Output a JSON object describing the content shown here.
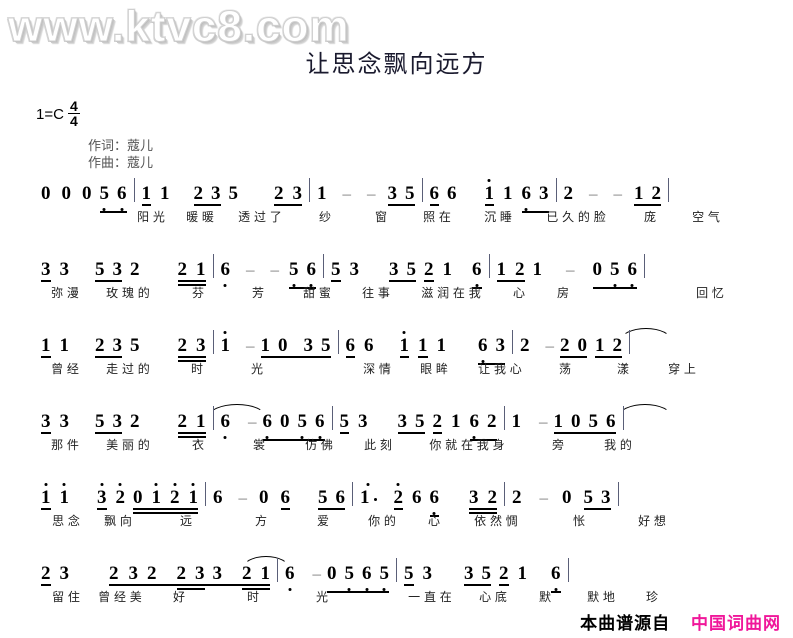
{
  "watermark": "www.ktvc8.com",
  "title": "让思念飘向远方",
  "key": {
    "tonic": "1=C",
    "meter_numerator": "4",
    "meter_denominator": "4"
  },
  "credits": {
    "lyricist": "作词：蔻儿",
    "composer": "作曲：蔻儿"
  },
  "footer": {
    "source_label": "本曲谱源自",
    "site_name": "中国词曲网",
    "site_color": "#f0179a"
  },
  "score": {
    "notation": "jianpu",
    "lines": [
      {
        "id": "line-1",
        "notes": "0 0 0 5̣ 6̣ | 1 1 2 3 5 | 2 3 | 1 - 3 5 | 6 6 | 1̇ 1 6 3 | 2 - - 1 2 |",
        "lyrics": "阳光 暖暖 透过了 纱 窗 照在 沉睡 已久的脸 庞 空气"
      },
      {
        "id": "line-2",
        "notes": "3 3 5 3 2 | 2 1 | 6̣ - - 5̣ 6̣ | 5 3 | 3 5 2 1 6̣ | 1 2 1 - 0 5̣ 6̣ |",
        "lyrics": "弥漫 玫瑰的 芬 芳 甜蜜 往事 滋润在我 心 房 回忆"
      },
      {
        "id": "line-3",
        "notes": "1 1 2 3 5 | 2 3 | 1̇ - 1 0 3 5 | 6 6 | 1̇ 1 1 | 6 3 | 2 - 2 0 1 2 |",
        "lyrics": "曾经 走过的 时 光 深情 眼眸 让我心 荡 漾 穿上"
      },
      {
        "id": "line-4",
        "notes": "3 3 5 3 2 | 2 1 | 6̣ - 6̣ 0 5̣ 6̣ | 5 3 | 3 5 2 1 6̣ 2 | 1 - 1 0 5 6 |",
        "lyrics": "那件 美丽的 衣 裳 仿佛 此刻 你就在我身 旁 我的"
      },
      {
        "id": "line-5",
        "notes": "1̇ 1̇ 3̇ 2̇ 0 1̇ 2̇ 1̇ | 6 - 0 6 5 6 | 1̇. 2̇ 6 6̣ 3 2 | 2 - 0 5 3 |",
        "lyrics": "思念 飘向 远 方 爱 你的 心 依然惆 怅 好想"
      },
      {
        "id": "line-6",
        "notes": "2 3 | 2 3 2 2 3 3 2 1 | 6̣ - 0 5̣ 6̣ 5̣ | 5 3 | 3 5 2 1 6̣ |",
        "lyrics": "留住 曾经美 好 时 光 一直在 心底 默 默地 珍"
      }
    ]
  }
}
